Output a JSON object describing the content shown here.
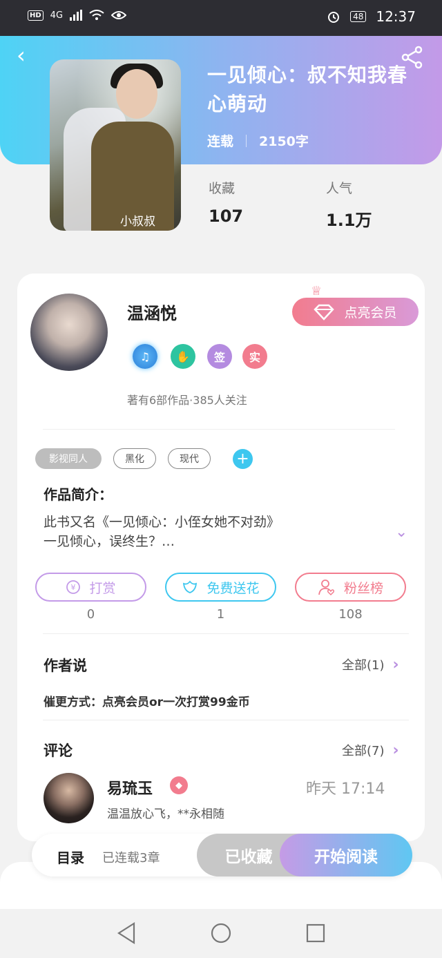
{
  "status": {
    "network": "4G",
    "battery": "48",
    "time": "12:37",
    "hd": "HD"
  },
  "book": {
    "title": "一见倾心：叔不知我春心萌动",
    "state": "连载",
    "words": "2150字",
    "cover_label": "小叔叔",
    "favorites_label": "收藏",
    "favorites": "107",
    "popularity_label": "人气",
    "popularity": "1.1万"
  },
  "author": {
    "name": "温涵悦",
    "vip_button": "点亮会员",
    "badges": [
      "music-badge",
      "handshake-badge",
      "签",
      "实"
    ],
    "works_line": "著有6部作品·385人关注"
  },
  "tags": {
    "items": [
      "影视同人",
      "黑化",
      "现代"
    ]
  },
  "intro": {
    "heading": "作品简介：",
    "line1": "此书又名《一见倾心：小侄女她不对劲》",
    "line2": "一见倾心，误终生？…"
  },
  "actions": [
    {
      "label": "打赏",
      "count": "0",
      "color": "#c39ae8"
    },
    {
      "label": "免费送花",
      "count": "1",
      "color": "#3ec7ef"
    },
    {
      "label": "粉丝榜",
      "count": "108",
      "color": "#f27c8e"
    }
  ],
  "author_says": {
    "heading": "作者说",
    "all": "全部(1)",
    "text": "催更方式：点亮会员or一次打赏99金币"
  },
  "comments": {
    "heading": "评论",
    "all": "全部(7)",
    "items": [
      {
        "name": "易琉玉",
        "time": "昨天 17:14",
        "text": "温温放心飞，**永相随"
      }
    ]
  },
  "bottom": {
    "toc": "目录",
    "chapters": "已连载3章",
    "collected": "已收藏",
    "read": "开始阅读"
  },
  "colors": {
    "accent_blue": "#3ec7ef",
    "accent_purple": "#c39ae8",
    "accent_pink": "#f27c8e"
  }
}
